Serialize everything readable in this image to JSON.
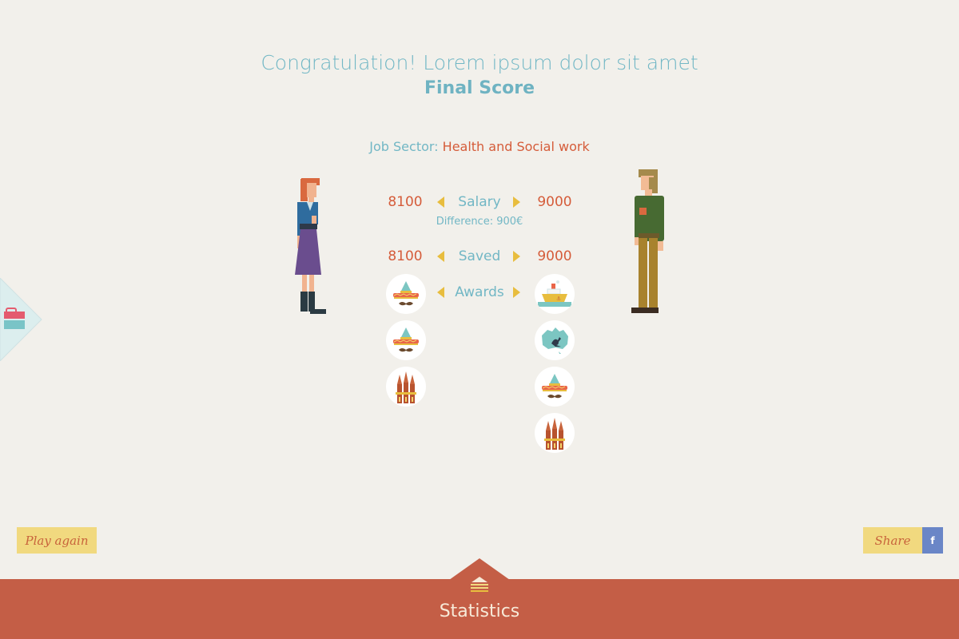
{
  "header": {
    "congrats": "Congratulation! Lorem ipsum dolor sit amet",
    "final_score": "Final Score"
  },
  "sector": {
    "label": "Job Sector: ",
    "value": "Health and Social work"
  },
  "comparison": {
    "salary": {
      "label": "Salary",
      "left": "8100",
      "right": "9000",
      "difference": "Difference: 900€"
    },
    "saved": {
      "label": "Saved",
      "left": "8100",
      "right": "9000"
    },
    "awards": {
      "label": "Awards",
      "left": [
        "sombrero-icon",
        "sombrero-icon",
        "sagrada-familia-icon"
      ],
      "right": [
        "ship-icon",
        "australia-kangaroo-icon",
        "sombrero-icon",
        "sagrada-familia-icon"
      ]
    }
  },
  "characters": {
    "left": "woman-character",
    "right": "man-character"
  },
  "buttons": {
    "play_again": "Play again",
    "share": "Share",
    "facebook": "f"
  },
  "footer": {
    "label": "Statistics",
    "icon": "stats-stack-icon"
  },
  "side_tab": {
    "icon": "toolbox-icon"
  },
  "colors": {
    "background": "#f2f0eb",
    "teal": "#72b7c5",
    "accent": "#d55c3a",
    "yellow": "#e8bd3e",
    "button": "#f1d97f",
    "footer": "#c45e46",
    "facebook": "#6a86c7"
  }
}
